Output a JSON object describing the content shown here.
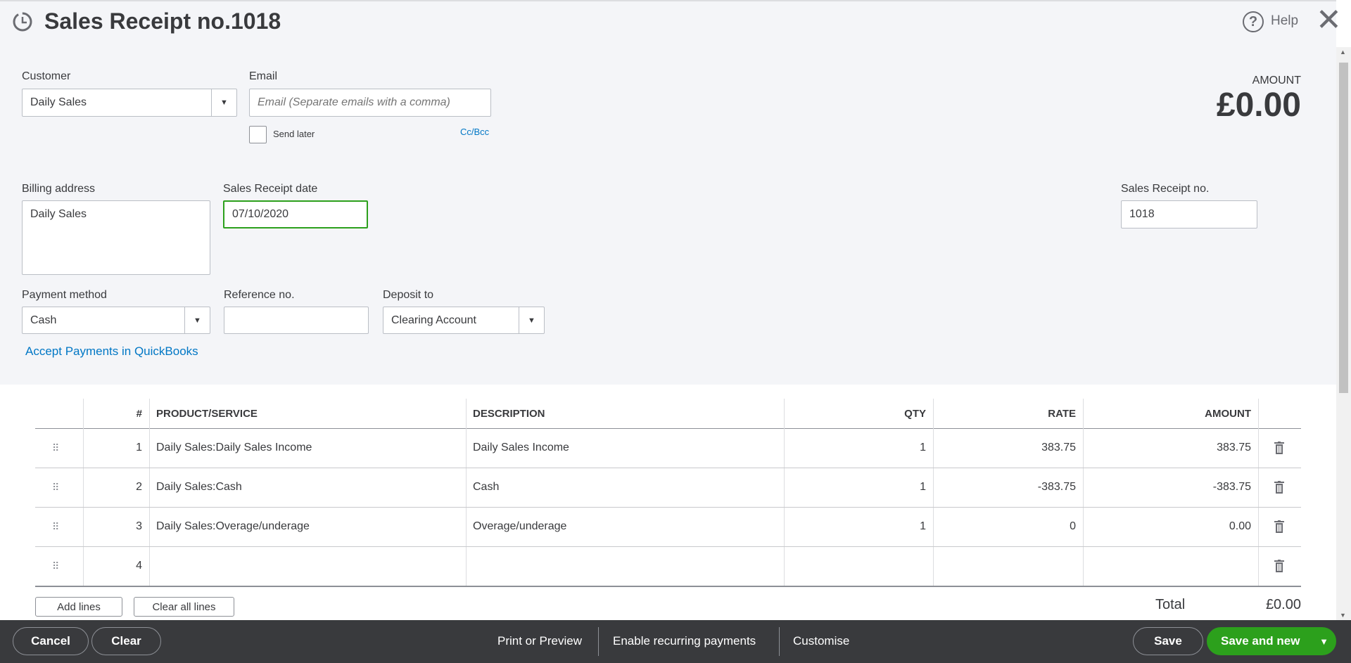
{
  "header": {
    "title": "Sales Receipt no.1018",
    "help": "Help"
  },
  "form": {
    "customer_label": "Customer",
    "customer_value": "Daily Sales",
    "email_label": "Email",
    "email_placeholder": "Email (Separate emails with a comma)",
    "send_later": "Send later",
    "ccbcc": "Cc/Bcc",
    "amount_label": "AMOUNT",
    "amount_value": "£0.00",
    "billing_label": "Billing address",
    "billing_value": "Daily Sales",
    "date_label": "Sales Receipt date",
    "date_value": "07/10/2020",
    "receipt_no_label": "Sales Receipt no.",
    "receipt_no_value": "1018",
    "payment_label": "Payment method",
    "payment_value": "Cash",
    "reference_label": "Reference no.",
    "reference_value": "",
    "deposit_label": "Deposit to",
    "deposit_value": "Clearing Account",
    "accept_link": "Accept Payments in QuickBooks"
  },
  "table": {
    "headers": [
      "#",
      "PRODUCT/SERVICE",
      "DESCRIPTION",
      "QTY",
      "RATE",
      "AMOUNT"
    ],
    "rows": [
      {
        "n": "1",
        "product": "Daily Sales:Daily Sales Income",
        "description": "Daily Sales Income",
        "qty": "1",
        "rate": "383.75",
        "amount": "383.75"
      },
      {
        "n": "2",
        "product": "Daily Sales:Cash",
        "description": "Cash",
        "qty": "1",
        "rate": "-383.75",
        "amount": "-383.75"
      },
      {
        "n": "3",
        "product": "Daily Sales:Overage/underage",
        "description": "Overage/underage",
        "qty": "1",
        "rate": "0",
        "amount": "0.00"
      },
      {
        "n": "4",
        "product": "",
        "description": "",
        "qty": "",
        "rate": "",
        "amount": ""
      }
    ],
    "add_lines": "Add lines",
    "clear_all_lines": "Clear all lines",
    "total_label": "Total",
    "total_value": "£0.00"
  },
  "footer": {
    "cancel": "Cancel",
    "clear": "Clear",
    "print": "Print or Preview",
    "recurring": "Enable recurring payments",
    "customise": "Customise",
    "save": "Save",
    "save_new": "Save and new"
  }
}
